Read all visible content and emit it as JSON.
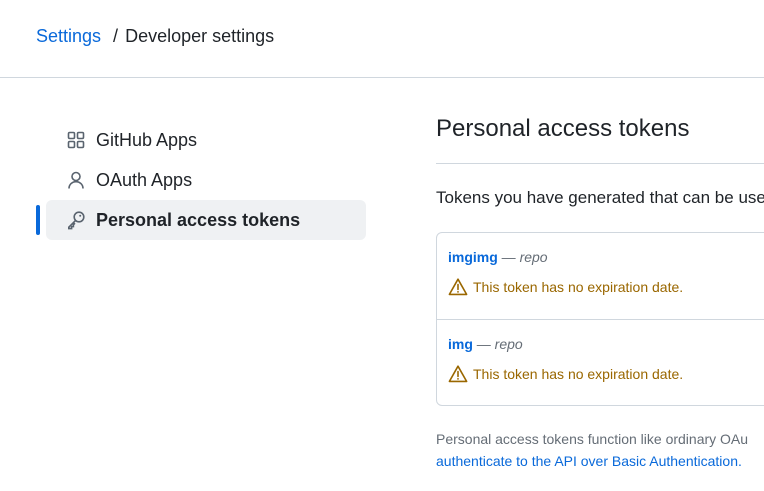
{
  "breadcrumb": {
    "root": "Settings",
    "separator": "/",
    "current": "Developer settings"
  },
  "sidebar": {
    "items": [
      {
        "label": "GitHub Apps",
        "icon": "apps-grid-icon",
        "active": false
      },
      {
        "label": "OAuth Apps",
        "icon": "person-icon",
        "active": false
      },
      {
        "label": "Personal access tokens",
        "icon": "key-icon",
        "active": true
      }
    ]
  },
  "main": {
    "title": "Personal access tokens",
    "intro": "Tokens you have generated that can be use",
    "tokens": [
      {
        "name": "imgimg",
        "dash": "—",
        "scope": "repo",
        "warning": "This token has no expiration date."
      },
      {
        "name": "img",
        "dash": "—",
        "scope": "repo",
        "warning": "This token has no expiration date."
      }
    ],
    "footer_line1": "Personal access tokens function like ordinary OAu",
    "footer_link": "authenticate to the API over Basic Authentication."
  },
  "colors": {
    "link": "#0969da",
    "warning": "#9a6700",
    "border": "#d0d7de",
    "active_bg": "#eff1f3"
  }
}
